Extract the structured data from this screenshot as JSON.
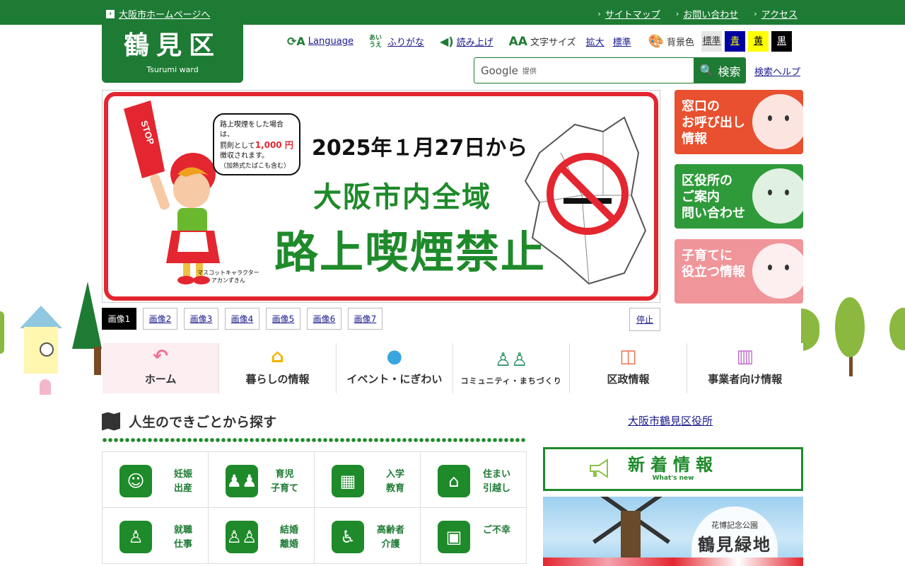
{
  "topbar": {
    "home_link": "大阪市ホームページへ",
    "links": [
      "サイトマップ",
      "お問い合わせ",
      "アクセス"
    ]
  },
  "logo": {
    "title": "鶴見区",
    "subtitle": "Tsurumi ward"
  },
  "tools": {
    "language": "Language",
    "furigana_icon": "あいうえ",
    "furigana": "ふりがな",
    "read_aloud": "読み上げ",
    "text_size_label": "文字サイズ",
    "text_size_large": "拡大",
    "text_size_normal": "標準",
    "bg_label": "背景色",
    "bg_options": [
      {
        "label": "標準",
        "bg": "#e6e6e6",
        "fg": "#333333"
      },
      {
        "label": "青",
        "bg": "#0000a0",
        "fg": "#ffff00"
      },
      {
        "label": "黄",
        "bg": "#ffff00",
        "fg": "#000000"
      },
      {
        "label": "黒",
        "bg": "#000000",
        "fg": "#ffffff"
      }
    ]
  },
  "search": {
    "brand": "Google",
    "provided": "提供",
    "button": "検索",
    "help": "検索ヘルプ"
  },
  "banner": {
    "date_line": "2025年１月27日から",
    "line1": "大阪市内全域",
    "line2": "路上喫煙禁止",
    "bubble_1": "路上喫煙をした場合は、",
    "bubble_2a": "罰則として",
    "bubble_fine": "1,000 円",
    "bubble_3": "徴収されます。",
    "bubble_4": "（加熱式たばこも含む）",
    "mascot_1": "マスコットキャラクター",
    "mascot_2": "アカンずきん",
    "stop_text": "STOP"
  },
  "slider": {
    "thumbs": [
      "画像1",
      "画像2",
      "画像3",
      "画像4",
      "画像5",
      "画像6",
      "画像7"
    ],
    "active_index": 0,
    "stop": "停止"
  },
  "side_cards": [
    {
      "text": "窓口の\nお呼び出し\n情報",
      "color": "#e8502f"
    },
    {
      "text": "区役所の\nご案内\n問い合わせ",
      "color": "#2e9a3a"
    },
    {
      "text": "子育てに\n役立つ情報",
      "color": "#f0959a"
    }
  ],
  "nav": [
    {
      "label": "ホーム",
      "icon": "↶",
      "icon_name": "home-return-icon",
      "color": "#f0709a"
    },
    {
      "label": "暮らしの情報",
      "icon": "⌂",
      "icon_name": "house-icon",
      "color": "#f0b400"
    },
    {
      "label": "イベント・にぎわい",
      "icon": "●",
      "icon_name": "balloon-icon",
      "color": "#3aa6e0"
    },
    {
      "label": "コミュニティ・まちづくり",
      "icon": "♙♙",
      "icon_name": "people-icon",
      "color": "#1e8a5a"
    },
    {
      "label": "区政情報",
      "icon": "◫",
      "icon_name": "meeting-icon",
      "color": "#f07050"
    },
    {
      "label": "事業者向け情報",
      "icon": "▥",
      "icon_name": "chart-icon",
      "color": "#c070d0"
    }
  ],
  "life_events": {
    "title": "人生のできごとから探す",
    "items": [
      {
        "line1": "妊娠",
        "line2": "出産",
        "icon": "☺",
        "icon_name": "pregnancy-icon"
      },
      {
        "line1": "育児",
        "line2": "子育て",
        "icon": "♟♟",
        "icon_name": "childcare-icon"
      },
      {
        "line1": "入学",
        "line2": "教育",
        "icon": "▦",
        "icon_name": "school-icon"
      },
      {
        "line1": "住まい",
        "line2": "引越し",
        "icon": "⌂",
        "icon_name": "housing-icon"
      },
      {
        "line1": "就職",
        "line2": "仕事",
        "icon": "♙",
        "icon_name": "employment-icon"
      },
      {
        "line1": "結婚",
        "line2": "離婚",
        "icon": "♙♙",
        "icon_name": "marriage-icon"
      },
      {
        "line1": "高齢者",
        "line2": "介護",
        "icon": "♿",
        "icon_name": "wheelchair-icon"
      },
      {
        "line1": "ご不幸",
        "line2": "",
        "icon": "▣",
        "icon_name": "condolence-icon"
      }
    ]
  },
  "right": {
    "office_link": "大阪市鶴見区役所",
    "news_title": "新着情報",
    "news_sub": "What's new",
    "photo_small": "花博記念公園",
    "photo_big": "鶴見緑地"
  }
}
